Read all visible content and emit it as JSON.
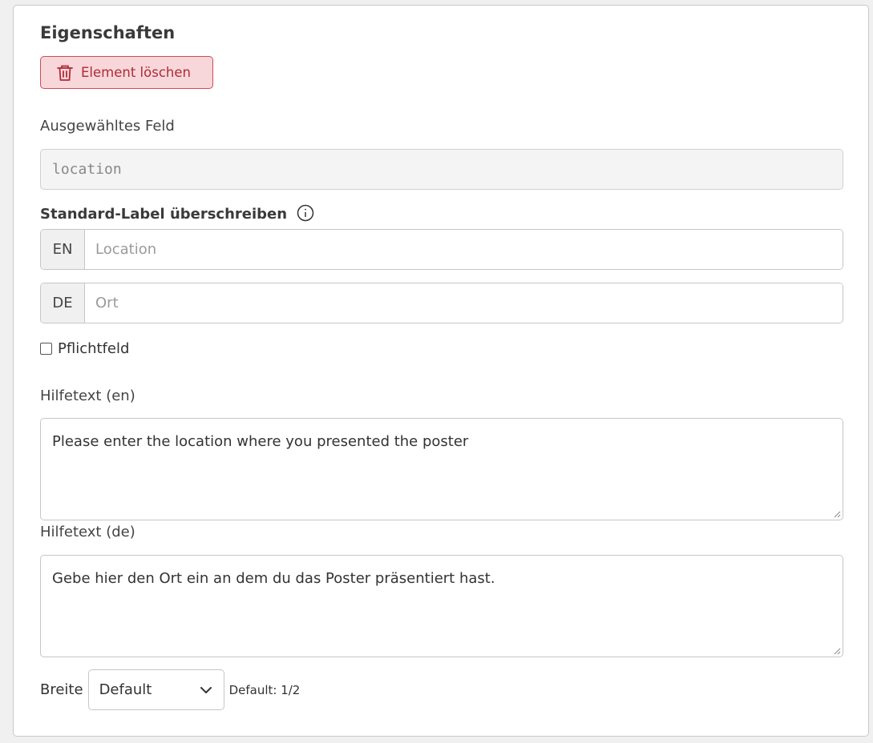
{
  "panel": {
    "title": "Eigenschaften",
    "delete_button": "Element löschen"
  },
  "selected_field": {
    "label": "Ausgewähltes Feld",
    "value": "location"
  },
  "label_override": {
    "label": "Standard-Label überschreiben",
    "rows": [
      {
        "lang": "EN",
        "placeholder": "Location",
        "value": ""
      },
      {
        "lang": "DE",
        "placeholder": "Ort",
        "value": ""
      }
    ]
  },
  "required": {
    "label": "Pflichtfeld",
    "checked": false
  },
  "helptext_en": {
    "label": "Hilfetext (en)",
    "value": "Please enter the location where you presented the poster"
  },
  "helptext_de": {
    "label": "Hilfetext (de)",
    "value": "Gebe hier den Ort ein an dem du das Poster präsentiert hast."
  },
  "width": {
    "label": "Breite",
    "selected": "Default",
    "hint": "Default: 1/2"
  },
  "colors": {
    "danger_bg": "#f8d7da",
    "danger_border": "#d04a55",
    "danger_text": "#b02a37"
  },
  "icons": {
    "delete": "trash-icon",
    "info": "info-circle-icon",
    "select": "chevron-down-icon"
  }
}
